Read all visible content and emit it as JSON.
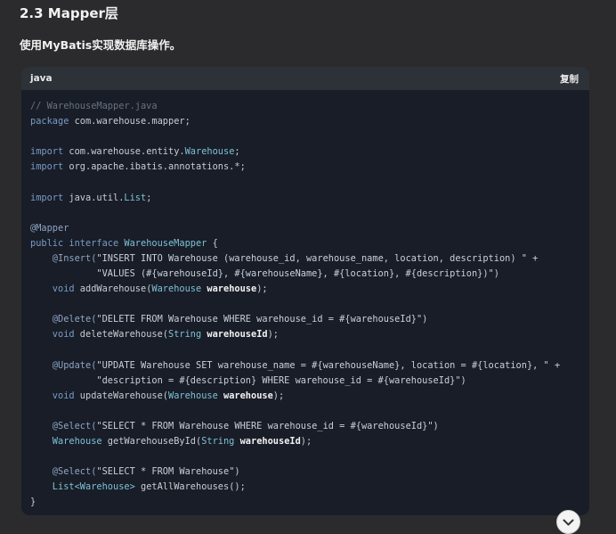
{
  "section": {
    "heading": "2.3 Mapper层",
    "intro": "使用MyBatis实现数据库操作。"
  },
  "code_block": {
    "language": "java",
    "copy_label": "复制",
    "lines": [
      [
        {
          "t": "// WarehouseMapper.java",
          "c": "comment"
        }
      ],
      [
        {
          "t": "package ",
          "c": "keyword"
        },
        {
          "t": "com.warehouse.mapper;",
          "c": "plain"
        }
      ],
      [],
      [
        {
          "t": "import ",
          "c": "keyword"
        },
        {
          "t": "com.warehouse.entity.",
          "c": "plain"
        },
        {
          "t": "Warehouse",
          "c": "type"
        },
        {
          "t": ";",
          "c": "plain"
        }
      ],
      [
        {
          "t": "import ",
          "c": "keyword"
        },
        {
          "t": "org.apache.ibatis.annotations.*;",
          "c": "plain"
        }
      ],
      [],
      [
        {
          "t": "import ",
          "c": "keyword"
        },
        {
          "t": "java.util.",
          "c": "plain"
        },
        {
          "t": "List",
          "c": "type"
        },
        {
          "t": ";",
          "c": "plain"
        }
      ],
      [],
      [
        {
          "t": "@Mapper",
          "c": "annotation"
        }
      ],
      [
        {
          "t": "public interface ",
          "c": "keyword"
        },
        {
          "t": "WarehouseMapper",
          "c": "type"
        },
        {
          "t": " {",
          "c": "plain"
        }
      ],
      [
        {
          "t": "    @Insert(",
          "c": "annotation"
        },
        {
          "t": "\"INSERT INTO Warehouse (warehouse_id, warehouse_name, location, description) \" +",
          "c": "string"
        }
      ],
      [
        {
          "t": "            \"VALUES (#{warehouseId}, #{warehouseName}, #{location}, #{description})\")",
          "c": "string"
        }
      ],
      [
        {
          "t": "    void ",
          "c": "keyword"
        },
        {
          "t": "addWarehouse(",
          "c": "plain"
        },
        {
          "t": "Warehouse ",
          "c": "type"
        },
        {
          "t": "warehouse",
          "c": "bold"
        },
        {
          "t": ");",
          "c": "plain"
        }
      ],
      [],
      [
        {
          "t": "    @Delete(",
          "c": "annotation"
        },
        {
          "t": "\"DELETE FROM Warehouse WHERE warehouse_id = #{warehouseId}\")",
          "c": "string"
        }
      ],
      [
        {
          "t": "    void ",
          "c": "keyword"
        },
        {
          "t": "deleteWarehouse(",
          "c": "plain"
        },
        {
          "t": "String ",
          "c": "type"
        },
        {
          "t": "warehouseId",
          "c": "bold"
        },
        {
          "t": ");",
          "c": "plain"
        }
      ],
      [],
      [
        {
          "t": "    @Update(",
          "c": "annotation"
        },
        {
          "t": "\"UPDATE Warehouse SET warehouse_name = #{warehouseName}, location = #{location}, \" +",
          "c": "string"
        }
      ],
      [
        {
          "t": "            \"description = #{description} WHERE warehouse_id = #{warehouseId}\")",
          "c": "string"
        }
      ],
      [
        {
          "t": "    void ",
          "c": "keyword"
        },
        {
          "t": "updateWarehouse(",
          "c": "plain"
        },
        {
          "t": "Warehouse ",
          "c": "type"
        },
        {
          "t": "warehouse",
          "c": "bold"
        },
        {
          "t": ");",
          "c": "plain"
        }
      ],
      [],
      [
        {
          "t": "    @Select(",
          "c": "annotation"
        },
        {
          "t": "\"SELECT * FROM Warehouse WHERE warehouse_id = #{warehouseId}\")",
          "c": "string"
        }
      ],
      [
        {
          "t": "    Warehouse ",
          "c": "type"
        },
        {
          "t": "getWarehouseById(",
          "c": "plain"
        },
        {
          "t": "String ",
          "c": "type"
        },
        {
          "t": "warehouseId",
          "c": "bold"
        },
        {
          "t": ");",
          "c": "plain"
        }
      ],
      [],
      [
        {
          "t": "    @Select(",
          "c": "annotation"
        },
        {
          "t": "\"SELECT * FROM Warehouse\")",
          "c": "string"
        }
      ],
      [
        {
          "t": "    List<Warehouse> ",
          "c": "type"
        },
        {
          "t": "getAllWarehouses();",
          "c": "plain"
        }
      ],
      [
        {
          "t": "}",
          "c": "plain"
        }
      ]
    ]
  },
  "scroll_button": {
    "icon": "chevron-down-icon"
  },
  "colors": {
    "page_bg": "#2b2b2d",
    "code_bg": "#181d27",
    "code_header_bg": "#2d3138",
    "keyword": "#7a9ac7",
    "type": "#7ec0d6",
    "comment": "#6a7280"
  }
}
